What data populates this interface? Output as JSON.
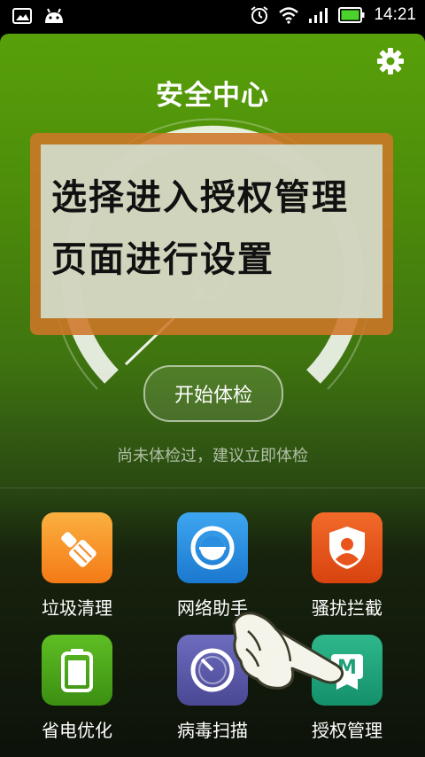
{
  "status_bar": {
    "time": "14:21"
  },
  "header": {
    "title": "安全中心"
  },
  "overlay": {
    "line1": "选择进入授权管理",
    "line2": "页面进行设置"
  },
  "main": {
    "check_button": "开始体检",
    "hint": "尚未体检过，建议立即体检"
  },
  "tools": [
    {
      "label": "垃圾清理",
      "icon": "broom-icon",
      "color": "#f7931e"
    },
    {
      "label": "网络助手",
      "icon": "network-icon",
      "color": "#2a8fe0"
    },
    {
      "label": "骚扰拦截",
      "icon": "shield-person-icon",
      "color": "#e8541b"
    },
    {
      "label": "省电优化",
      "icon": "battery-icon",
      "color": "#4ca51c"
    },
    {
      "label": "病毒扫描",
      "icon": "scan-icon",
      "color": "#5a59a8"
    },
    {
      "label": "授权管理",
      "icon": "authorization-icon",
      "color": "#1fa178"
    }
  ]
}
